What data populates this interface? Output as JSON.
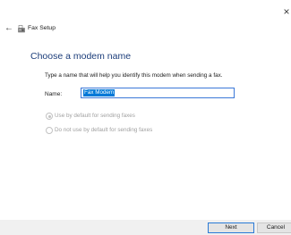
{
  "window": {
    "title": "Fax Setup",
    "close_glyph": "×",
    "back_glyph": "←"
  },
  "page": {
    "heading": "Choose a modem name",
    "instruction": "Type a name that will help you identify this modem when sending a fax."
  },
  "form": {
    "name_label": "Name:",
    "name_value": "Fax Modem"
  },
  "options": [
    {
      "label": "Use by default for sending faxes",
      "selected": true,
      "enabled": false
    },
    {
      "label": "Do not use by default for sending faxes",
      "selected": false,
      "enabled": false
    }
  ],
  "buttons": {
    "next": "Next",
    "cancel": "Cancel"
  },
  "colors": {
    "heading": "#1c3d7a",
    "accent": "#0078d7",
    "disabled_text": "#a0a0a0"
  },
  "icons": {
    "title": "fax-icon",
    "back": "back-arrow-icon",
    "close": "close-icon"
  }
}
